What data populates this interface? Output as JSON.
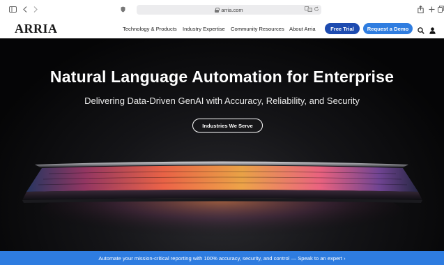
{
  "browser": {
    "url": "arria.com"
  },
  "header": {
    "logo": "ARRIA",
    "nav": [
      {
        "label": "Technology & Products"
      },
      {
        "label": "Industry Expertise"
      },
      {
        "label": "Community Resources"
      },
      {
        "label": "About Arria"
      }
    ],
    "free_trial_label": "Free Trial",
    "request_demo_label": "Request a Demo"
  },
  "hero": {
    "title": "Natural Language Automation for Enterprise",
    "subtitle": "Delivering Data-Driven GenAI with Accuracy, Reliability, and Security",
    "cta_label": "Industries We Serve"
  },
  "banner": {
    "text": "Automate your mission-critical reporting with 100% accuracy, security, and control — Speak to an expert ›"
  },
  "colors": {
    "primary_dark_blue": "#1d4bb0",
    "primary_blue": "#2f7de0",
    "banner_blue": "#2e7ce0",
    "hero_bg": "#0b0b0d"
  },
  "icons": [
    "sidebar-icon",
    "back-arrow-icon",
    "forward-arrow-icon",
    "privacy-shield-icon",
    "lock-icon",
    "translate-icon",
    "reload-icon",
    "share-icon",
    "new-tab-icon",
    "tabs-icon",
    "search-icon",
    "user-icon"
  ]
}
